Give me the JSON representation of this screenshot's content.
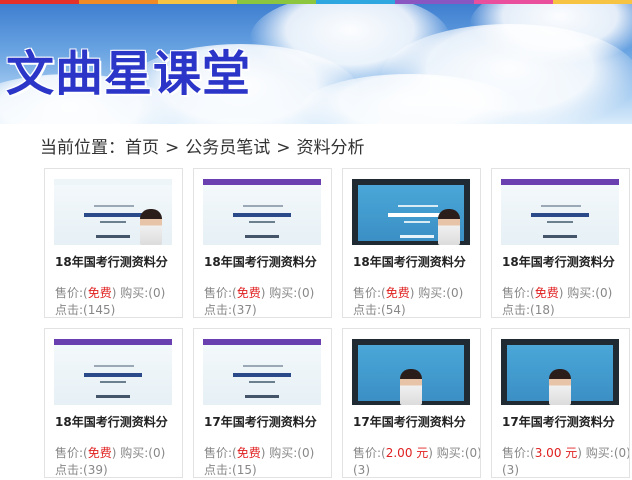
{
  "colors": {
    "rainbow": [
      "#e4322b",
      "#f08a24",
      "#f6c343",
      "#8cc63f",
      "#2ea7e0",
      "#8a56c2",
      "#e94f9c",
      "#f6c343"
    ],
    "title": "#2b36c8",
    "free": "#e02020"
  },
  "site": {
    "title": "文曲星课堂"
  },
  "breadcrumb": {
    "prefix": "当前位置：",
    "items": [
      "首页",
      "公务员笔试",
      "资料分析"
    ],
    "separator": ">"
  },
  "cards": [
    {
      "title": "18年国考行测资料分",
      "price_label": "售价:(",
      "price": "免费",
      "price_close": ")",
      "buy_label": "购买:(",
      "buy": "0",
      "buy_close": ")",
      "clicks_label": "点击:(",
      "clicks": "145",
      "clicks_close": ")",
      "thumb": "teacher-right"
    },
    {
      "title": "18年国考行测资料分",
      "price_label": "售价:(",
      "price": "免费",
      "price_close": ")",
      "buy_label": "购买:(",
      "buy": "0",
      "buy_close": ")",
      "clicks_label": "点击:(",
      "clicks": "37",
      "clicks_close": ")",
      "thumb": "slide"
    },
    {
      "title": "18年国考行测资料分",
      "price_label": "售价:(",
      "price": "免费",
      "price_close": ")",
      "buy_label": "购买:(",
      "buy": "0",
      "buy_close": ")",
      "clicks_label": "点击:(",
      "clicks": "54",
      "clicks_close": ")",
      "thumb": "teacher-right-frame"
    },
    {
      "title": "18年国考行测资料分",
      "price_label": "售价:(",
      "price": "免费",
      "price_close": ")",
      "buy_label": "购买:(",
      "buy": "0",
      "buy_close": ")",
      "clicks_label": "点击:(",
      "clicks": "18",
      "clicks_close": ")",
      "thumb": "slide"
    },
    {
      "title": "18年国考行测资料分",
      "price_label": "售价:(",
      "price": "免费",
      "price_close": ")",
      "buy_label": "购买:(",
      "buy": "0",
      "buy_close": ")",
      "clicks_label": "点击:(",
      "clicks": "39",
      "clicks_close": ")",
      "thumb": "slide"
    },
    {
      "title": "17年国考行测资料分",
      "price_label": "售价:(",
      "price": "免费",
      "price_close": ")",
      "buy_label": "购买:(",
      "buy": "0",
      "buy_close": ")",
      "clicks_label": "点击:(",
      "clicks": "15",
      "clicks_close": ")",
      "thumb": "slide"
    },
    {
      "title": "17年国考行测资料分",
      "price_label": "售价:(",
      "price": "2.00 元",
      "price_close": ")",
      "buy_label": "购买:(",
      "buy": "0",
      "buy_close": ")",
      "clicks_label": "",
      "clicks": "(3)",
      "clicks_close": "",
      "thumb": "teacher-center-frame"
    },
    {
      "title": "17年国考行测资料分",
      "price_label": "售价:(",
      "price": "3.00 元",
      "price_close": ")",
      "buy_label": "购买:(",
      "buy": "0",
      "buy_close": ")",
      "clicks_label": "",
      "clicks": "(3)",
      "clicks_close": "",
      "thumb": "teacher-center-frame"
    }
  ]
}
